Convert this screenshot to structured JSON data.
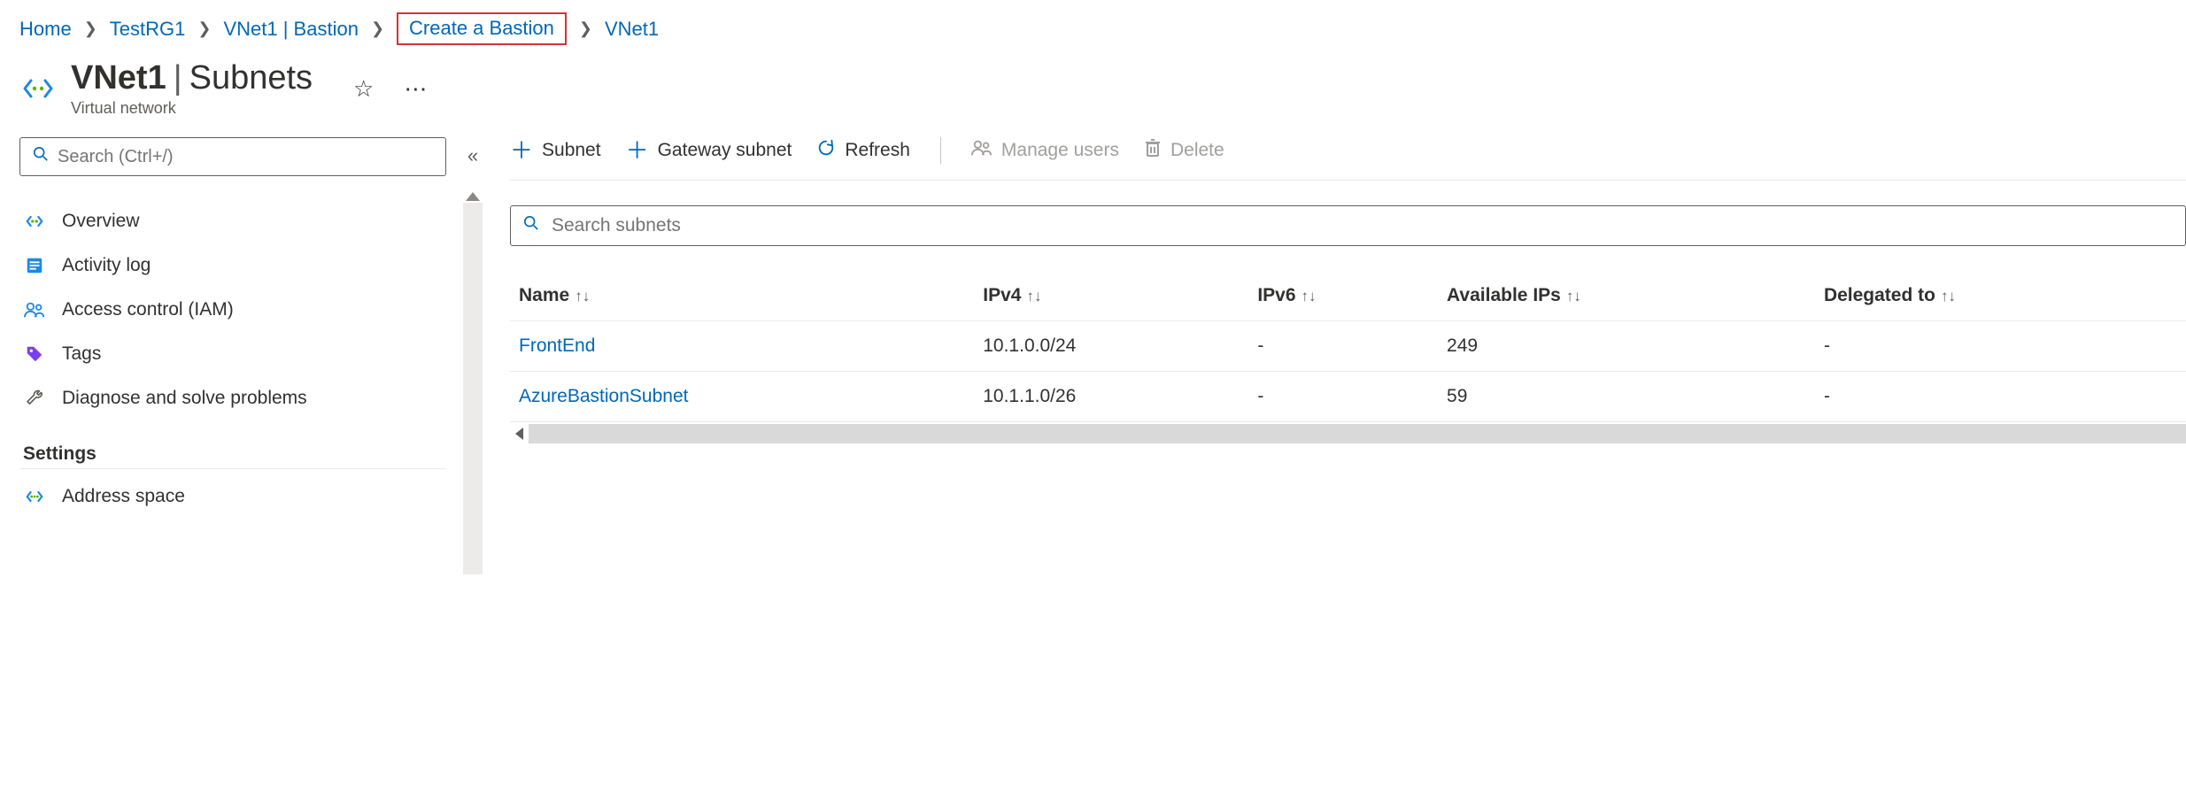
{
  "breadcrumbs": {
    "home": "Home",
    "rg": "TestRG1",
    "vnetBastion": "VNet1 | Bastion",
    "createBastion": "Create a Bastion",
    "vnet": "VNet1"
  },
  "header": {
    "resource": "VNet1",
    "section": "Subnets",
    "type": "Virtual network"
  },
  "sidebar": {
    "searchPlaceholder": "Search (Ctrl+/)",
    "items": {
      "overview": "Overview",
      "activityLog": "Activity log",
      "iam": "Access control (IAM)",
      "tags": "Tags",
      "diagnose": "Diagnose and solve problems"
    },
    "settingsHeader": "Settings",
    "settings": {
      "addressSpace": "Address space"
    }
  },
  "toolbar": {
    "subnet": "Subnet",
    "gatewaySubnet": "Gateway subnet",
    "refresh": "Refresh",
    "manageUsers": "Manage users",
    "delete": "Delete"
  },
  "filter": {
    "placeholder": "Search subnets"
  },
  "columns": {
    "name": "Name",
    "ipv4": "IPv4",
    "ipv6": "IPv6",
    "availableIps": "Available IPs",
    "delegatedTo": "Delegated to"
  },
  "rows": [
    {
      "name": "FrontEnd",
      "ipv4": "10.1.0.0/24",
      "ipv6": "-",
      "availableIps": "249",
      "delegatedTo": "-"
    },
    {
      "name": "AzureBastionSubnet",
      "ipv4": "10.1.1.0/26",
      "ipv6": "-",
      "availableIps": "59",
      "delegatedTo": "-"
    }
  ]
}
